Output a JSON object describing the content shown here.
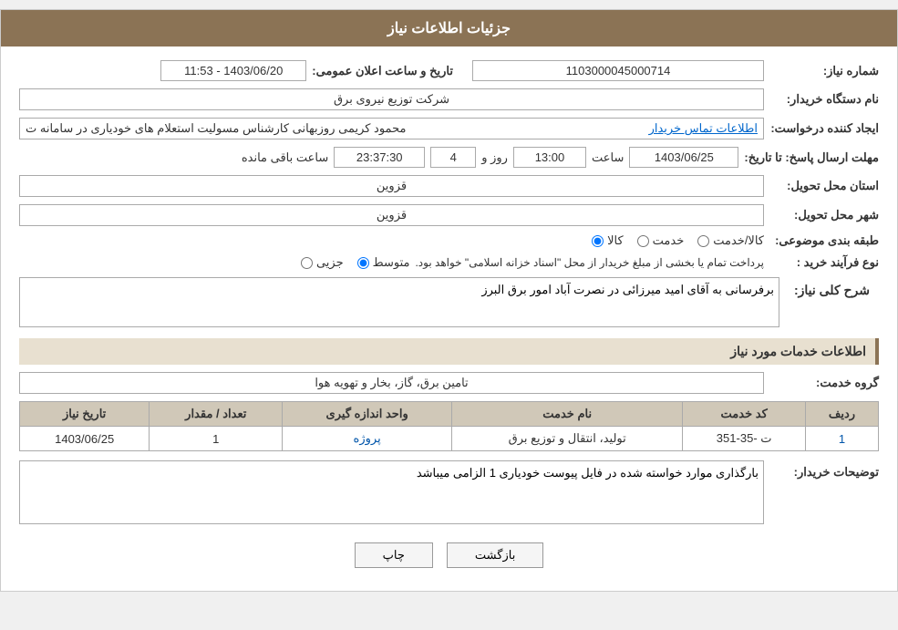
{
  "header": {
    "title": "جزئیات اطلاعات نیاز"
  },
  "form": {
    "need_number_label": "شماره نیاز:",
    "need_number_value": "1103000045000714",
    "announce_date_label": "تاریخ و ساعت اعلان عمومی:",
    "announce_date_value": "1403/06/20 - 11:53",
    "buyer_org_label": "نام دستگاه خریدار:",
    "buyer_org_value": "شرکت توزیع نیروی برق",
    "creator_label": "ایجاد کننده درخواست:",
    "creator_value": "محمود کریمی روزبهانی کارشناس  مسولیت استعلام های خودیاری در سامانه ت",
    "creator_link": "اطلاعات تماس خریدار",
    "deadline_label": "مهلت ارسال پاسخ: تا تاریخ:",
    "deadline_date": "1403/06/25",
    "deadline_time_label": "ساعت",
    "deadline_time": "13:00",
    "deadline_days_label": "روز و",
    "deadline_days": "4",
    "deadline_remaining_label": "ساعت باقی مانده",
    "deadline_remaining": "23:37:30",
    "province_label": "استان محل تحویل:",
    "province_value": "قزوین",
    "city_label": "شهر محل تحویل:",
    "city_value": "قزوین",
    "category_label": "طبقه بندی موضوعی:",
    "category_options": [
      "کالا",
      "خدمت",
      "کالا/خدمت"
    ],
    "category_selected": "کالا",
    "purchase_type_label": "نوع فرآیند خرید :",
    "purchase_type_options": [
      "جزیی",
      "متوسط"
    ],
    "purchase_type_selected": "متوسط",
    "purchase_type_description": "پرداخت تمام یا بخشی از مبلغ خریدار از محل \"اسناد خزانه اسلامی\" خواهد بود.",
    "need_description_label": "شرح کلی نیاز:",
    "need_description_value": "برفرسانی به آقای امید میرزائی در نصرت آباد امور برق البرز",
    "services_label": "اطلاعات خدمات مورد نیاز",
    "service_group_label": "گروه خدمت:",
    "service_group_value": "تامین برق، گاز، بخار و تهویه هوا",
    "table": {
      "headers": [
        "ردیف",
        "کد خدمت",
        "نام خدمت",
        "واحد اندازه گیری",
        "تعداد / مقدار",
        "تاریخ نیاز"
      ],
      "rows": [
        {
          "row": "1",
          "code": "ت -35-351",
          "name": "تولید، انتقال و توزیع برق",
          "unit": "پروژه",
          "count": "1",
          "date": "1403/06/25"
        }
      ]
    },
    "buyer_desc_label": "توضیحات خریدار:",
    "buyer_desc_value": "بارگذاری موارد خواسته شده در فایل پیوست خودیاری 1 الزامی میباشد",
    "btn_print": "چاپ",
    "btn_back": "بازگشت"
  }
}
